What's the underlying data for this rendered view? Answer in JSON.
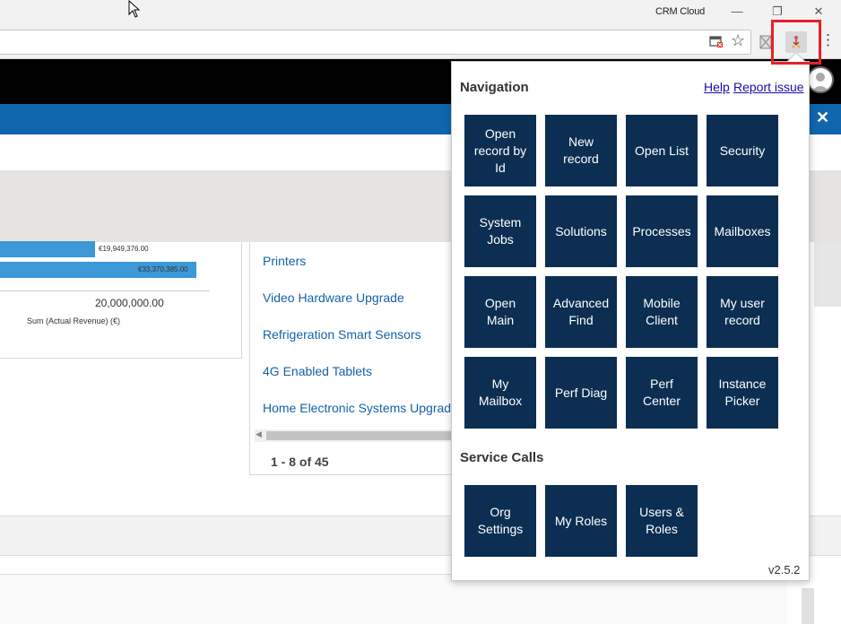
{
  "window": {
    "title": "CRM Cloud",
    "minimize_glyph": "—",
    "restore_glyph": "❐",
    "close_glyph": "✕"
  },
  "toolbar": {
    "bookmark_glyph": "☆",
    "menu_glyph": "⋮"
  },
  "crm": {
    "close_glyph": "✕",
    "chart": {
      "bar1_label": "€19,949,376.00",
      "bar2_label": "€33,370,385.00",
      "axis_tick": "20,000,000.00",
      "axis_title": "Sum (Actual Revenue) (€)"
    },
    "list": {
      "items": [
        "Printers",
        "Video Hardware Upgrade",
        "Refrigeration Smart Sensors",
        "4G Enabled Tablets",
        "Home Electronic Systems Upgrade"
      ],
      "pager": "1 - 8 of 45"
    }
  },
  "popup": {
    "navigation_title": "Navigation",
    "help_link": "Help",
    "report_link": "Report issue",
    "navigation_tiles": [
      "Open record by Id",
      "New record",
      "Open List",
      "Security",
      "System Jobs",
      "Solutions",
      "Processes",
      "Mailboxes",
      "Open Main",
      "Advanced Find",
      "Mobile Client",
      "My user record",
      "My Mailbox",
      "Perf Diag",
      "Perf Center",
      "Instance Picker"
    ],
    "service_calls_title": "Service Calls",
    "service_tiles": [
      "Org Settings",
      "My Roles",
      "Users & Roles"
    ],
    "version": "v2.5.2"
  },
  "colors": {
    "tile_bg": "#0b2e52",
    "crm_blue": "#0f66ad",
    "highlight": "#e8202a"
  }
}
